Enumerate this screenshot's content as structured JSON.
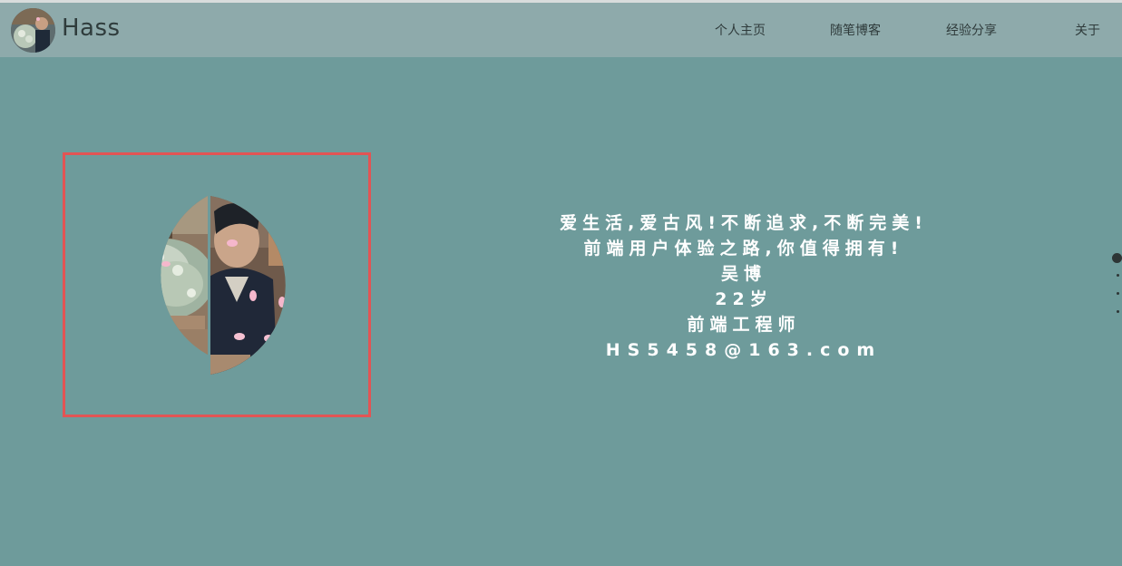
{
  "header": {
    "brand": "Hass",
    "nav": [
      "个人主页",
      "随笔博客",
      "经验分享",
      "关于"
    ]
  },
  "profile": {
    "lines": [
      "爱生活,爱古风!不断追求,不断完美!",
      "前端用户体验之路,你值得拥有!",
      "吴博",
      "22岁",
      "前端工程师",
      "HS5458@163.com"
    ]
  },
  "colors": {
    "background": "#6e9b9b",
    "navbar": "#8eaaab",
    "frame_border": "#e25454",
    "text": "#ffffff"
  },
  "icons": [
    "logo-avatar-image",
    "profile-photo-image",
    "slide-indicator-dots"
  ]
}
